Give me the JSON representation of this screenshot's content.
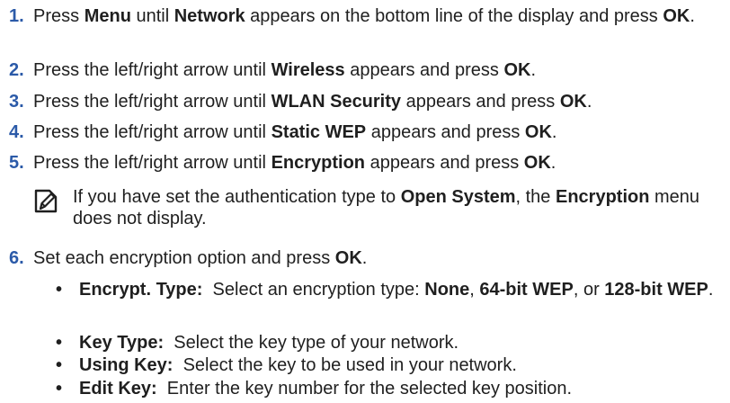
{
  "steps": [
    {
      "num": "1.",
      "parts": [
        "Press ",
        "Menu",
        " until ",
        "Network",
        " appears on the bottom line of the display and press ",
        "OK",
        "."
      ]
    },
    {
      "num": "2.",
      "parts": [
        "Press the left/right arrow until ",
        "Wireless",
        " appears and press ",
        "OK",
        "."
      ]
    },
    {
      "num": "3.",
      "parts": [
        "Press the left/right arrow until ",
        "WLAN Security",
        " appears and press ",
        "OK",
        "."
      ]
    },
    {
      "num": "4.",
      "parts": [
        "Press the left/right arrow until ",
        "Static WEP",
        " appears and press ",
        "OK",
        "."
      ]
    },
    {
      "num": "5.",
      "parts": [
        "Press the left/right arrow until ",
        "Encryption",
        " appears and press ",
        "OK",
        "."
      ]
    }
  ],
  "note": {
    "icon": "note-pencil-icon",
    "parts": [
      "If you have set the authentication type to ",
      "Open System",
      ", the ",
      "Encryption",
      " menu does not display."
    ]
  },
  "step6": {
    "num": "6.",
    "parts": [
      "Set each encryption option and press ",
      "OK",
      "."
    ]
  },
  "bullet_char": "•",
  "options": [
    {
      "parts": [
        "Encrypt. Type:",
        "  Select an encryption type: ",
        "None",
        ", ",
        "64-bit WEP",
        ", or ",
        "128-bit WEP",
        "."
      ]
    },
    {
      "parts": [
        "Key Type:",
        "  Select the key type of your network."
      ]
    },
    {
      "parts": [
        "Using Key:",
        "  Select the key to be used in your network."
      ]
    },
    {
      "parts": [
        "Edit Key:",
        "  Enter the key number for the selected key position."
      ]
    }
  ]
}
